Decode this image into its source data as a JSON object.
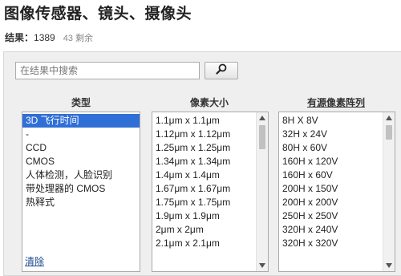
{
  "title": "图像传感器、镜头、摄像头",
  "results": {
    "label": "结果：",
    "count": "1389",
    "remaining": "43 剩余"
  },
  "search": {
    "placeholder": "在结果中搜索",
    "value": "",
    "button_icon": "search-icon"
  },
  "facets": [
    {
      "title": "类型",
      "items": [
        "3D 飞行时间",
        "-",
        "CCD",
        "CMOS",
        "人体检测，人脸识别",
        "带处理器的 CMOS",
        "热释式"
      ],
      "selected_index": 0
    },
    {
      "title": "像素大小",
      "items": [
        "1.1μm x 1.1μm",
        "1.12μm x 1.12μm",
        "1.25μm x 1.25μm",
        "1.34μm x 1.34μm",
        "1.4μm x 1.4μm",
        "1.67μm x 1.67μm",
        "1.75μm x 1.75μm",
        "1.9μm x 1.9μm",
        "2μm x 2μm",
        "2.1μm x 2.1μm"
      ],
      "selected_index": -1
    },
    {
      "title": "有源像素阵列",
      "items": [
        "8H X 8V",
        "32H x 24V",
        "80H x 60V",
        "160H x 120V",
        "160H x 60V",
        "200H x 150V",
        "200H x 200V",
        "250H x 250V",
        "320H x 240V",
        "320H x 320V"
      ],
      "selected_index": -1
    }
  ],
  "clear_label": "清除",
  "colors": {
    "selected": "#2f6fd6",
    "panel": "#efefef",
    "link": "#1a4a8a"
  }
}
